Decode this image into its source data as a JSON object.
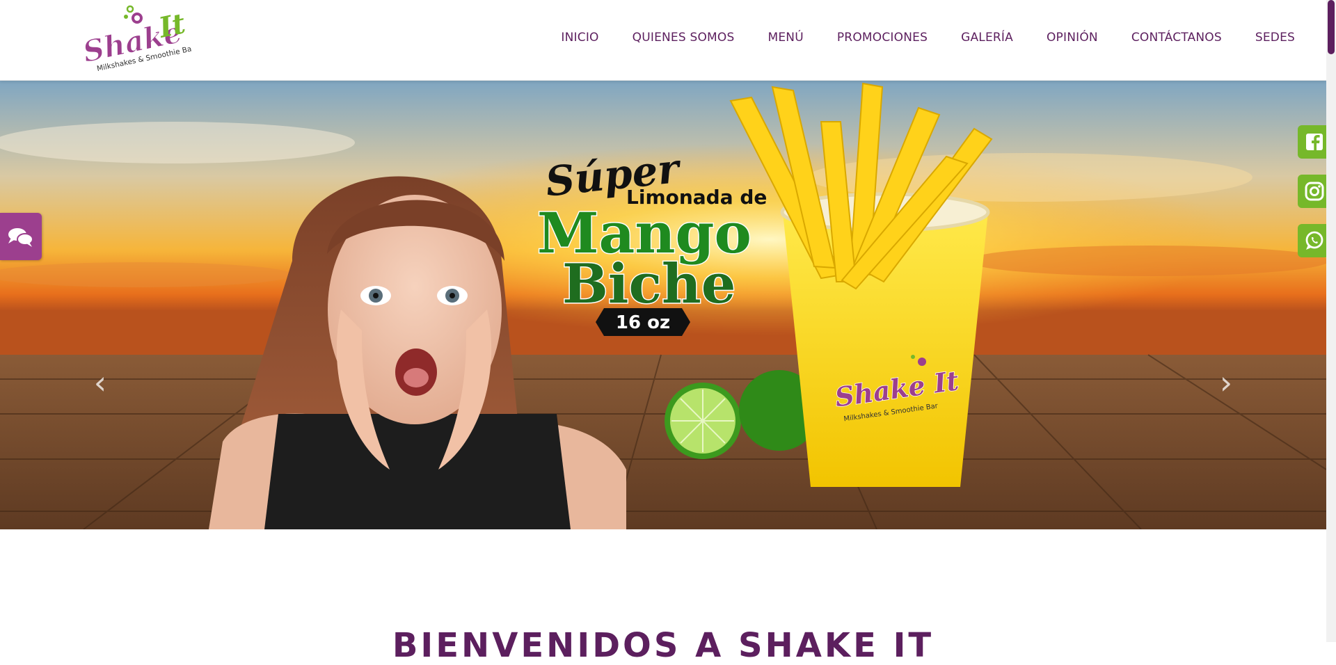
{
  "brand": {
    "name": "Shake It",
    "tagline": "Milkshakes & Smoothie Bar",
    "colors": {
      "primary": "#5c1f5e",
      "accent_green": "#76b82a",
      "purple": "#9c3f8e"
    }
  },
  "nav": {
    "items": [
      {
        "label": "INICIO"
      },
      {
        "label": "QUIENES SOMOS"
      },
      {
        "label": "MENÚ"
      },
      {
        "label": "PROMOCIONES"
      },
      {
        "label": "GALERÍA"
      },
      {
        "label": "OPINIÓN"
      },
      {
        "label": "CONTÁCTANOS"
      },
      {
        "label": "SEDES"
      }
    ]
  },
  "hero": {
    "headline_top": "Súper",
    "headline_mid": "Limonada de",
    "headline_main_1": "Mango",
    "headline_main_2": "Biche",
    "size": "16 oz",
    "cup_brand": "Shake It",
    "cup_tagline": "Milkshakes & Smoothie Bar",
    "prev_icon": "chevron-left-icon",
    "next_icon": "chevron-right-icon"
  },
  "floating": {
    "chat_icon": "chat-icon",
    "social": [
      {
        "icon": "facebook-icon"
      },
      {
        "icon": "instagram-icon"
      },
      {
        "icon": "whatsapp-icon"
      }
    ]
  },
  "section": {
    "welcome_title": "BIENVENIDOS A SHAKE IT"
  }
}
